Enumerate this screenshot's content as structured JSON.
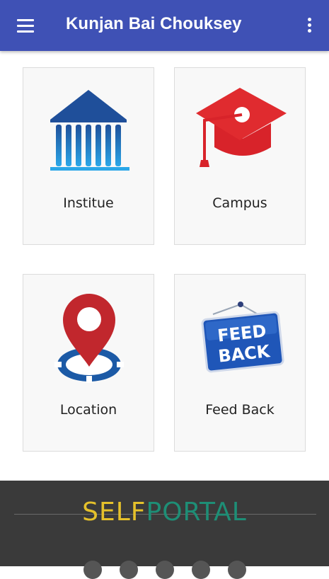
{
  "app_bar": {
    "title": "Kunjan Bai Chouksey",
    "menu_icon": "hamburger-menu-icon",
    "overflow_icon": "more-vertical-icon",
    "color": "#3F51B5"
  },
  "tiles": [
    {
      "label": "Institue",
      "icon": "institute-building-icon"
    },
    {
      "label": "Campus",
      "icon": "graduation-cap-icon"
    },
    {
      "label": "Location",
      "icon": "location-pin-icon"
    },
    {
      "label": "Feed Back",
      "icon": "feedback-sign-icon",
      "sign_line1": "FEED",
      "sign_line2": "BACK"
    }
  ],
  "footer": {
    "brand_part1": "SELF",
    "brand_part2": "PORTAL",
    "brand_color1": "#E5C12B",
    "brand_color2": "#1E8E76",
    "background": "#3a3a3a"
  }
}
